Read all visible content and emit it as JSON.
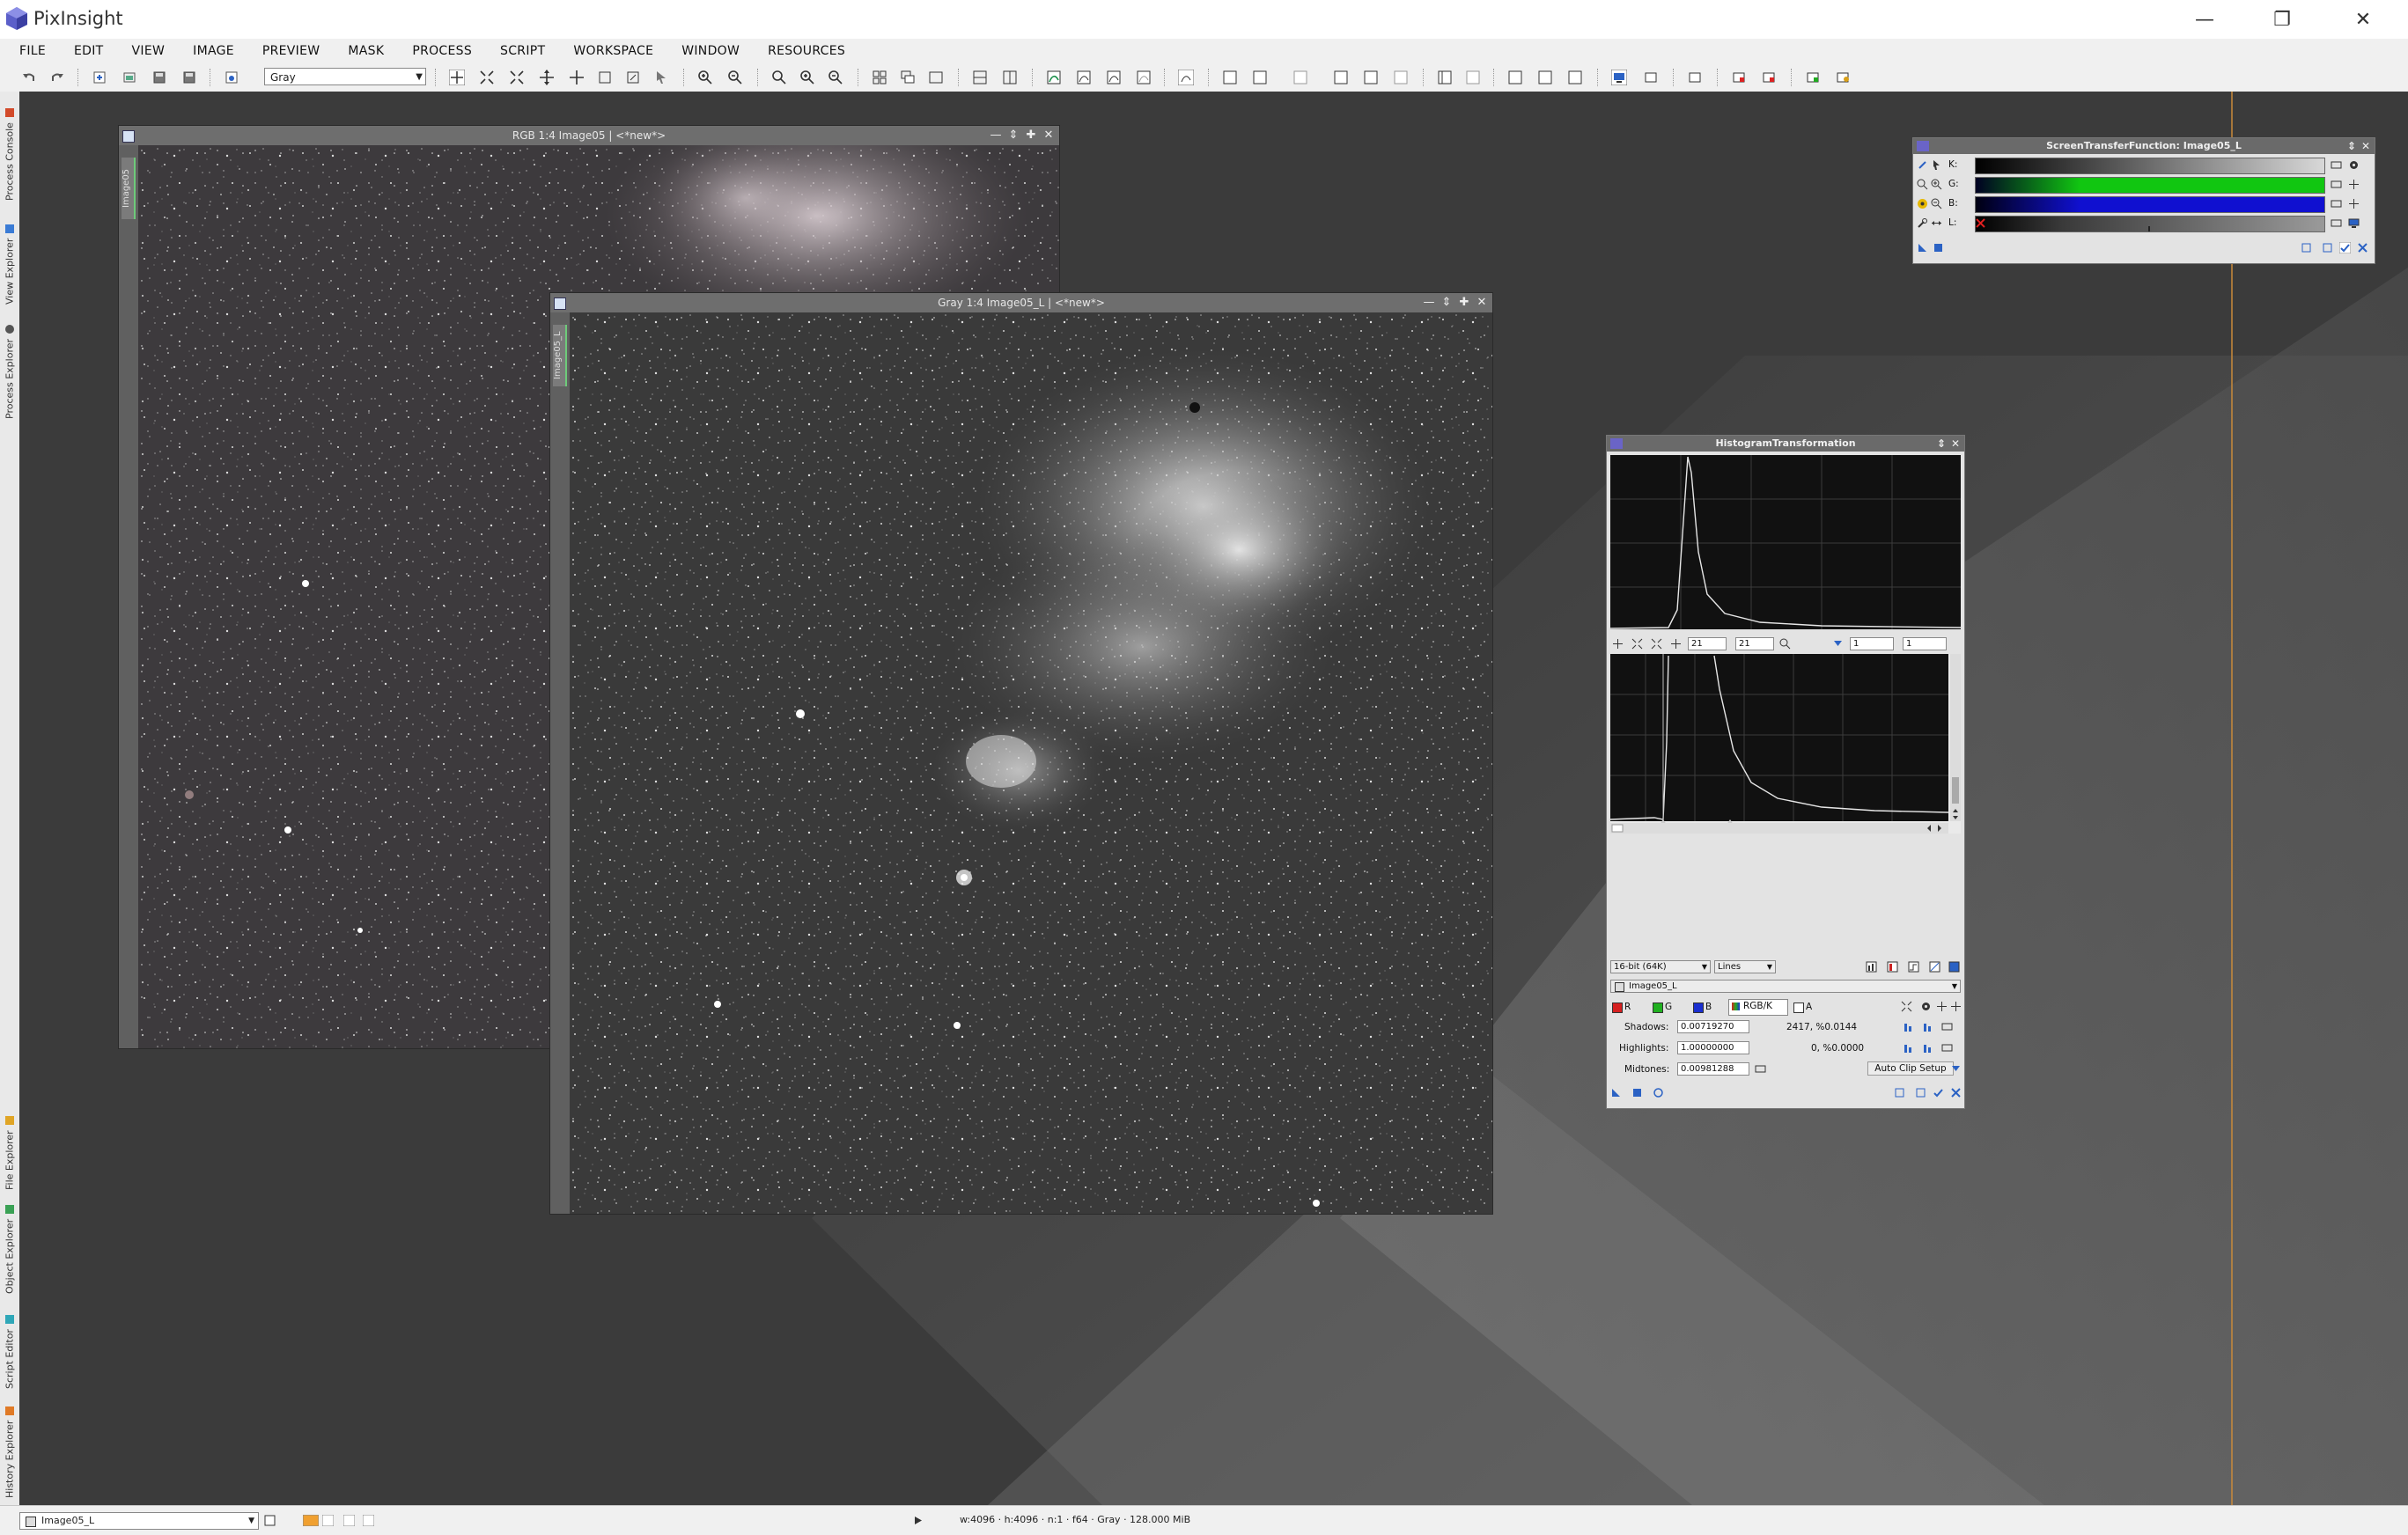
{
  "app": {
    "title": "PixInsight"
  },
  "menu": [
    "FILE",
    "EDIT",
    "VIEW",
    "IMAGE",
    "PREVIEW",
    "MASK",
    "PROCESS",
    "SCRIPT",
    "WORKSPACE",
    "WINDOW",
    "RESOURCES"
  ],
  "toolbar": {
    "view_mode": "Gray"
  },
  "left_dock": [
    "Process Console",
    "View Explorer",
    "Process Explorer",
    "File Explorer",
    "Object Explorer",
    "Script Editor",
    "History Explorer"
  ],
  "windows": {
    "rgb": {
      "title": "RGB 1:4 Image05 | <*new*>",
      "tab": "Image05"
    },
    "gray": {
      "title": "Gray 1:4 Image05_L | <*new*>",
      "tab": "Image05_L"
    }
  },
  "stf": {
    "title": "ScreenTransferFunction: Image05_L",
    "channels": [
      {
        "label": "K:",
        "color": "#d8d8d8"
      },
      {
        "label": "G:",
        "color": "#11c611"
      },
      {
        "label": "B:",
        "color": "#1010d0"
      },
      {
        "label": "L:",
        "color": "#9a9a9a"
      }
    ]
  },
  "ht": {
    "title": "HistogramTransformation",
    "zoom_h": "21",
    "zoom_v": "21",
    "zoom_h2": "1",
    "zoom_v2": "1",
    "resolution": "16-bit (64K)",
    "graph_style": "Lines",
    "view": "Image05_L",
    "ch_r": "R",
    "ch_g": "G",
    "ch_b": "B",
    "ch_rgbk": "RGB/K",
    "ch_a": "A",
    "shadows_label": "Shadows:",
    "shadows_value": "0.00719270",
    "shadows_clip": "2417, %0.0144",
    "highlights_label": "Highlights:",
    "highlights_value": "1.00000000",
    "highlights_clip": "0, %0.0000",
    "midtones_label": "Midtones:",
    "midtones_value": "0.00981288",
    "auto_clip": "Auto Clip Setup"
  },
  "status": {
    "view_select": "Image05_L",
    "info": "w:4096 · h:4096 · n:1 · f64 · Gray · 128.000 MiB"
  },
  "colors": {
    "accent_line": "#c98a3a",
    "histogram_bg": "#111111",
    "title_bg": "#6e6e6e"
  }
}
